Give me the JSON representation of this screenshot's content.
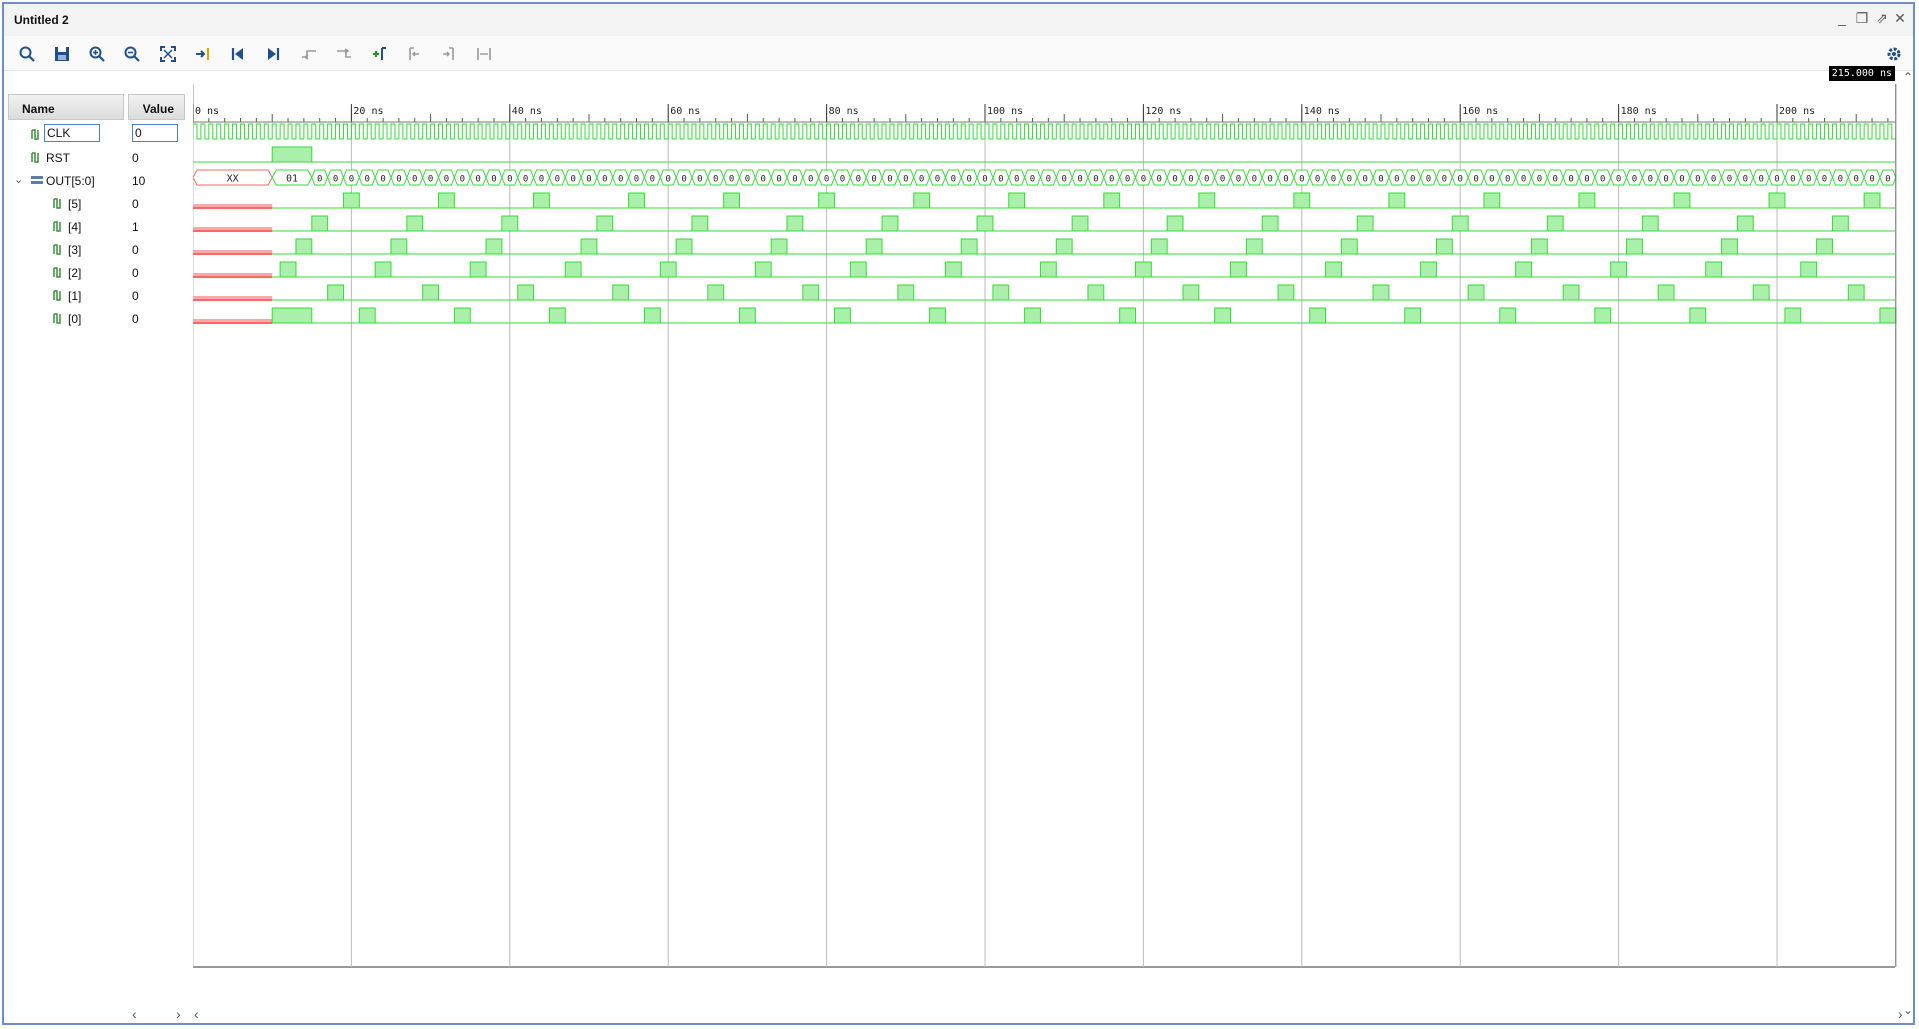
{
  "window": {
    "title": "Untitled 2"
  },
  "toolbar": {
    "buttons": [
      "search-icon",
      "save-icon",
      "zoom-in-icon",
      "zoom-out-icon",
      "zoom-fit-icon",
      "go-to-cursor-icon",
      "go-to-start-icon",
      "go-to-end-icon",
      "previous-transition-icon",
      "next-transition-icon",
      "add-marker-icon",
      "previous-marker-icon",
      "next-marker-icon",
      "swap-cursors-icon"
    ],
    "settings": "gear-icon"
  },
  "columns": {
    "name": "Name",
    "value": "Value"
  },
  "signals": [
    {
      "name": "CLK",
      "value": "0"
    },
    {
      "name": "RST",
      "value": "0"
    },
    {
      "name": "OUT[5:0]",
      "value": "10"
    },
    {
      "name": "[5]",
      "value": "0"
    },
    {
      "name": "[4]",
      "value": "1"
    },
    {
      "name": "[3]",
      "value": "0"
    },
    {
      "name": "[2]",
      "value": "0"
    },
    {
      "name": "[1]",
      "value": "0"
    },
    {
      "name": "[0]",
      "value": "0"
    }
  ],
  "time_axis": {
    "labels": [
      "0 ns",
      "20 ns",
      "40 ns",
      "60 ns",
      "80 ns",
      "100 ns",
      "120 ns",
      "140 ns",
      "160 ns",
      "180 ns",
      "200 ns"
    ],
    "cursor_time": "215.000 ns"
  },
  "bus_labels": {
    "unknown": "XX",
    "first": "01"
  },
  "colors": {
    "wave": "#33dd33",
    "wave_fill": "#aaf0aa",
    "unknown": "#ff6666",
    "unknown_fill": "#f7a8a8",
    "grid": "#bbbbbb",
    "border": "#6b8fc6"
  }
}
